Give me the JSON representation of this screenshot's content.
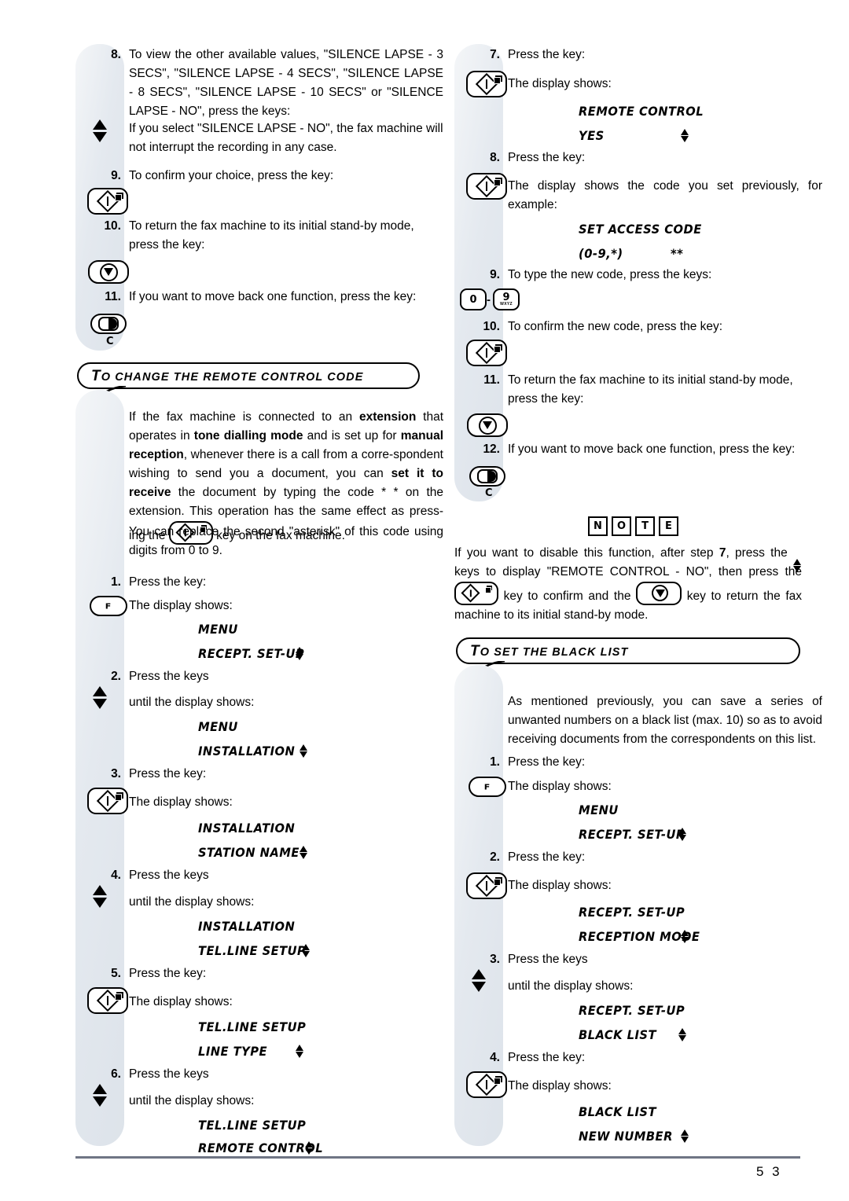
{
  "page": {
    "number": "5 3"
  },
  "left_column": {
    "steps": [
      {
        "num": "8.",
        "text": "To view the other available values, \"SILENCE LAPSE - 3 SECS\", \"SILENCE LAPSE - 4 SECS\", \"SILENCE LAPSE - 8 SECS\", \"SILENCE LAPSE - 10 SECS\" or \"SILENCE LAPSE - NO\", press the keys:"
      },
      {
        "num": "",
        "text": "If you select \"SILENCE LAPSE - NO\", the fax machine will not interrupt the recording in any case."
      },
      {
        "num": "9.",
        "text": "To confirm your choice, press the key:"
      },
      {
        "num": "10.",
        "text": "To return the fax machine to its initial stand-by mode, press the key:"
      },
      {
        "num": "11.",
        "text": "If you want to move back one function, press the key:"
      }
    ],
    "section": {
      "title_cap": "T",
      "title_rest": "O CHANGE THE REMOTE CONTROL CODE"
    },
    "intro_1_a": "If the fax machine is connected to an ",
    "intro_1_b": "extension",
    "intro_1_c": " that operates in ",
    "intro_1_d": "tone dialling mode",
    "intro_1_e": " and is set up for ",
    "intro_1_f": "manual reception",
    "intro_1_g": ", whenever there is a call from a  corre-spondent wishing to send you a document, you can ",
    "intro_1_h": "set it to receive",
    "intro_1_i": " the document by typing the code * * on the extension. This operation has the same effect as press-ing the ",
    "intro_1_j": " key on the fax machine.",
    "intro_2": "You can replace the second \"asterisk\" of this code using digits from 0 to 9.",
    "procedure": [
      {
        "num": "1.",
        "text": "Press the key:"
      },
      {
        "num": "",
        "text": "The display shows:"
      },
      {
        "num": "2.",
        "text": "Press the keys"
      },
      {
        "num": "",
        "text": "until the display shows:"
      },
      {
        "num": "3.",
        "text": "Press the key:"
      },
      {
        "num": "",
        "text": "The display shows:"
      },
      {
        "num": "4.",
        "text": "Press the keys"
      },
      {
        "num": "",
        "text": "until the display shows:"
      },
      {
        "num": "5.",
        "text": "Press the key:"
      },
      {
        "num": "",
        "text": "The display shows:"
      },
      {
        "num": "6.",
        "text": "Press the keys"
      },
      {
        "num": "",
        "text": "until the display shows:"
      }
    ],
    "displays": [
      {
        "line1": "MENU",
        "line2": "RECEPT. SET-UP"
      },
      {
        "line1": "MENU",
        "line2": "INSTALLATION"
      },
      {
        "line1": "INSTALLATION",
        "line2": "STATION NAME"
      },
      {
        "line1": "INSTALLATION",
        "line2": "TEL.LINE SETUP"
      },
      {
        "line1": "TEL.LINE SETUP",
        "line2": "LINE TYPE"
      },
      {
        "line1": "TEL.LINE SETUP",
        "line2": "REMOTE CONTROL"
      }
    ],
    "keys": {
      "f_label": "F",
      "cancel_label": "C"
    }
  },
  "right_column": {
    "steps": [
      {
        "num": "7.",
        "text": "Press the key:"
      },
      {
        "num": "",
        "text": "The display shows:"
      },
      {
        "num": "8.",
        "text": "Press the key:"
      },
      {
        "num": "",
        "text": "The display shows the code you set previously, for example:"
      },
      {
        "num": "9.",
        "text": "To type the new code, press the keys:"
      },
      {
        "num": "10.",
        "text": "To confirm the new code, press the key:"
      },
      {
        "num": "11.",
        "text": "To return the fax machine to its initial stand-by mode, press the key:"
      },
      {
        "num": "12.",
        "text": "If you want to move back one function, press the key:"
      }
    ],
    "displays": [
      {
        "line1": "REMOTE CONTROL",
        "line2": "YES"
      },
      {
        "line1": "SET ACCESS CODE",
        "line2": "(0-9,*)",
        "line2_extra": "**"
      }
    ],
    "digit_keys": {
      "from": "0",
      "sep": "-",
      "to": "9",
      "to_sub": "WXYZ"
    },
    "note": {
      "letters": [
        "N",
        "O",
        "T",
        "E"
      ],
      "text_a": "If you want to disable this function, after step ",
      "text_b": "7",
      "text_c": ", press the ",
      "text_d": " keys to display \"REMOTE CONTROL - NO\", then press the ",
      "text_e": " key to confirm and the ",
      "text_f": " key to return the fax machine to its initial stand-by mode."
    },
    "section": {
      "title_cap": "T",
      "title_rest": "O SET THE BLACK LIST"
    },
    "intro": "As mentioned previously, you can save a series of unwanted numbers on a black list (max. 10) so as to avoid receiving documents from the correspondents on this list.",
    "procedure": [
      {
        "num": "1.",
        "text": "Press the key:"
      },
      {
        "num": "",
        "text": "The display shows:"
      },
      {
        "num": "2.",
        "text": "Press the key:"
      },
      {
        "num": "",
        "text": "The display shows:"
      },
      {
        "num": "3.",
        "text": "Press the keys"
      },
      {
        "num": "",
        "text": "until the display shows:"
      },
      {
        "num": "4.",
        "text": "Press the key:"
      },
      {
        "num": "",
        "text": "The display shows:"
      }
    ],
    "bl_displays": [
      {
        "line1": "MENU",
        "line2": "RECEPT. SET-UP"
      },
      {
        "line1": "RECEPT. SET-UP",
        "line2": "RECEPTION MODE"
      },
      {
        "line1": "RECEPT. SET-UP",
        "line2": "BLACK LIST"
      },
      {
        "line1": "BLACK LIST",
        "line2": "NEW NUMBER"
      }
    ],
    "keys": {
      "f_label": "F",
      "cancel_label": "C"
    }
  }
}
